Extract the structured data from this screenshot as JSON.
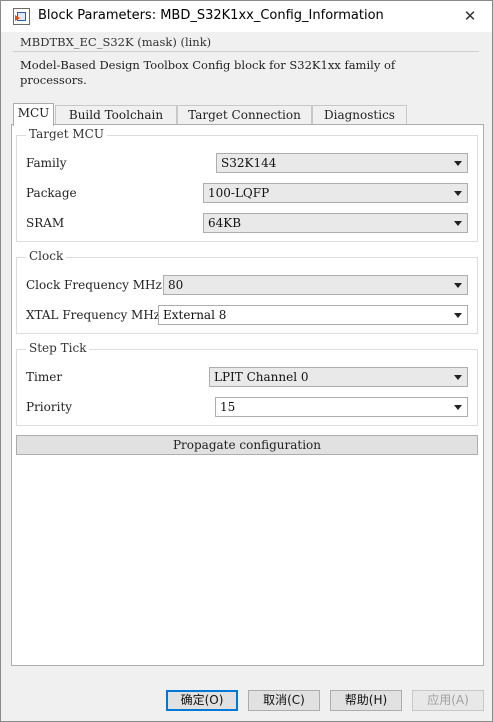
{
  "window": {
    "title": "Block Parameters: MBD_S32K1xx_Config_Information",
    "close_glyph": "✕"
  },
  "mask": {
    "header": "MBDTBX_EC_S32K (mask) (link)",
    "description": "Model-Based Design Toolbox Config block for S32K1xx family of processors."
  },
  "tabs": [
    {
      "label": "MCU",
      "active": true
    },
    {
      "label": "Build Toolchain",
      "active": false
    },
    {
      "label": "Target Connection",
      "active": false
    },
    {
      "label": "Diagnostics",
      "active": false
    }
  ],
  "target_mcu": {
    "title": "Target MCU",
    "family_label": "Family",
    "family_value": "S32K144",
    "package_label": "Package",
    "package_value": "100-LQFP",
    "sram_label": "SRAM",
    "sram_value": "64KB"
  },
  "clock": {
    "title": "Clock",
    "clock_freq_label": "Clock Frequency MHz",
    "clock_freq_value": "80",
    "xtal_freq_label": "XTAL Frequency MHz",
    "xtal_freq_value": "External 8"
  },
  "step_tick": {
    "title": "Step Tick",
    "timer_label": "Timer",
    "timer_value": "LPIT Channel 0",
    "priority_label": "Priority",
    "priority_value": "15"
  },
  "propagate_label": "Propagate configuration",
  "buttons": {
    "ok": "确定(O)",
    "cancel": "取消(C)",
    "help": "帮助(H)",
    "apply": "应用(A)"
  }
}
